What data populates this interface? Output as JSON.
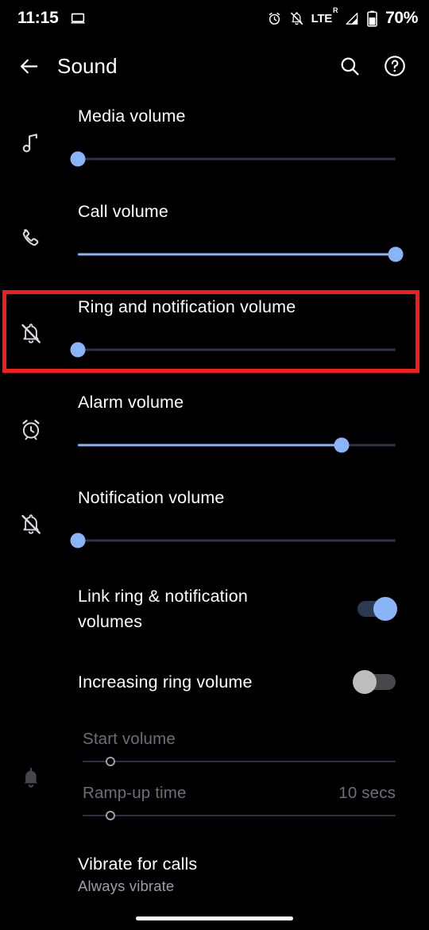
{
  "status_bar": {
    "time": "11:15",
    "left_icons": [
      "laptop-icon"
    ],
    "right_icons": [
      "alarm-icon",
      "notifications-off-icon",
      "signal-icon"
    ],
    "network_label": "LTE",
    "network_superscript": "R",
    "battery_percent": "70%"
  },
  "app_bar": {
    "back_icon": "arrow-back-icon",
    "title": "Sound",
    "search_icon": "search-icon",
    "help_icon": "help-icon"
  },
  "colors": {
    "accent": "#8ab4f8",
    "track": "#2f3545",
    "highlight": "#f41c1c",
    "background": "#000000",
    "text_primary": "#ffffff",
    "text_secondary": "#9aa0a6",
    "text_disabled": "#6c6f74"
  },
  "sliders": [
    {
      "id": "media-volume",
      "icon": "music-note-icon",
      "label": "Media volume",
      "value_percent": 0,
      "highlighted": false
    },
    {
      "id": "call-volume",
      "icon": "phone-icon",
      "label": "Call volume",
      "value_percent": 100,
      "highlighted": false
    },
    {
      "id": "ring-and-notification-volume",
      "icon": "notifications-off-icon",
      "label": "Ring and notification volume",
      "value_percent": 0,
      "highlighted": true
    },
    {
      "id": "alarm-volume",
      "icon": "alarm-icon",
      "label": "Alarm volume",
      "value_percent": 83,
      "highlighted": false
    },
    {
      "id": "notification-volume",
      "icon": "notifications-off-icon",
      "label": "Notification volume",
      "value_percent": 0,
      "highlighted": false
    }
  ],
  "toggles": [
    {
      "id": "link-ring-notification-volumes",
      "label": "Link ring & notification volumes",
      "checked": true
    },
    {
      "id": "increasing-ring-volume",
      "label": "Increasing ring volume",
      "checked": false
    }
  ],
  "increasing_ring_details": {
    "icon": "bell-ring-icon",
    "disabled": true,
    "items": [
      {
        "id": "start-volume",
        "label": "Start volume",
        "value_text": "",
        "value_percent": 9
      },
      {
        "id": "ramp-up-time",
        "label": "Ramp-up time",
        "value_text": "10 secs",
        "value_percent": 9
      }
    ]
  },
  "vibrate_for_calls": {
    "title": "Vibrate for calls",
    "summary": "Always vibrate"
  },
  "nav_bar": {
    "gesture_pill": "home-pill"
  }
}
